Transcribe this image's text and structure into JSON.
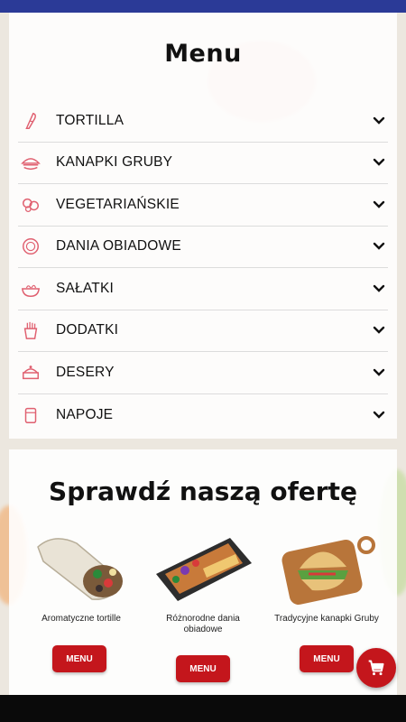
{
  "menu": {
    "title": "Menu",
    "categories": [
      {
        "label": "TORTILLA",
        "icon": "tortilla-icon"
      },
      {
        "label": "KANAPKI GRUBY",
        "icon": "sandwich-icon"
      },
      {
        "label": "VEGETARIAŃSKIE",
        "icon": "vegetarian-icon"
      },
      {
        "label": "DANIA OBIADOWE",
        "icon": "dinner-plate-icon"
      },
      {
        "label": "SAŁATKI",
        "icon": "salad-icon"
      },
      {
        "label": "DODATKI",
        "icon": "fries-icon"
      },
      {
        "label": "DESERY",
        "icon": "dessert-icon"
      },
      {
        "label": "NAPOJE",
        "icon": "drink-icon"
      }
    ]
  },
  "offer": {
    "title": "Sprawdź naszą ofertę",
    "items": [
      {
        "caption": "Aromatyczne tortille",
        "button": "MENU",
        "image": "tortilla-wrap-image"
      },
      {
        "caption": "Różnorodne dania obiadowe",
        "button": "MENU",
        "image": "dinner-dish-image"
      },
      {
        "caption": "Tradycyjne kanapki Gruby",
        "button": "MENU",
        "image": "sandwich-board-image"
      }
    ]
  },
  "colors": {
    "accent": "#c4161c",
    "topbar": "#2b3a97",
    "icon": "#e06070"
  },
  "cart": {
    "icon": "cart-icon"
  }
}
